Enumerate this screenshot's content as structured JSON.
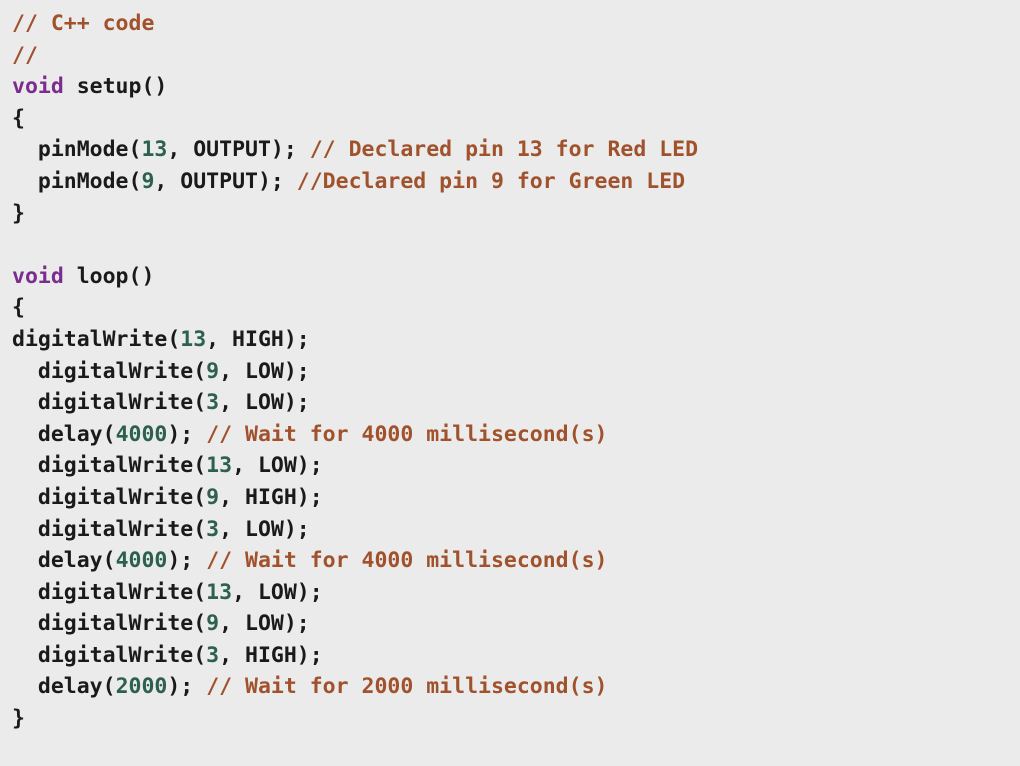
{
  "document": {
    "kind": "code-listing",
    "language": "C++",
    "background_color": "#ebebeb",
    "colors": {
      "plain": "#1a1a1a",
      "keyword": "#7b2d8e",
      "number": "#2d6050",
      "comment": "#a0522d"
    },
    "full_text": "// C++ code\n//\nvoid setup()\n{\n  pinMode(13, OUTPUT); // Declared pin 13 for Red LED\n  pinMode(9, OUTPUT); //Declared pin 9 for Green LED\n}\n\nvoid loop()\n{\ndigitalWrite(13, HIGH);\n  digitalWrite(9, LOW);\n  digitalWrite(3, LOW);\n  delay(4000); // Wait for 4000 millisecond(s)\n  digitalWrite(13, LOW);\n  digitalWrite(9, HIGH);\n  digitalWrite(3, LOW);\n  delay(4000); // Wait for 4000 millisecond(s)\n  digitalWrite(13, LOW);\n  digitalWrite(9, LOW);\n  digitalWrite(3, HIGH);\n  delay(2000); // Wait for 2000 millisecond(s)\n}",
    "lines": [
      {
        "id": 1,
        "text": "// C++ code",
        "tokens": [
          {
            "t": "// C++ code",
            "c": "comment"
          }
        ]
      },
      {
        "id": 2,
        "text": "//",
        "tokens": [
          {
            "t": "//",
            "c": "comment"
          }
        ]
      },
      {
        "id": 3,
        "text": "void setup()",
        "tokens": [
          {
            "t": "void",
            "c": "keyword"
          },
          {
            "t": " setup()",
            "c": "plain"
          }
        ]
      },
      {
        "id": 4,
        "text": "{",
        "tokens": [
          {
            "t": "{",
            "c": "plain"
          }
        ]
      },
      {
        "id": 5,
        "text": "  pinMode(13, OUTPUT); // Declared pin 13 for Red LED",
        "tokens": [
          {
            "t": "  pinMode(",
            "c": "plain"
          },
          {
            "t": "13",
            "c": "number"
          },
          {
            "t": ", OUTPUT); ",
            "c": "plain"
          },
          {
            "t": "// Declared pin 13 for Red LED",
            "c": "comment"
          }
        ]
      },
      {
        "id": 6,
        "text": "  pinMode(9, OUTPUT); //Declared pin 9 for Green LED",
        "tokens": [
          {
            "t": "  pinMode(",
            "c": "plain"
          },
          {
            "t": "9",
            "c": "number"
          },
          {
            "t": ", OUTPUT); ",
            "c": "plain"
          },
          {
            "t": "//Declared pin 9 for Green LED",
            "c": "comment"
          }
        ]
      },
      {
        "id": 7,
        "text": "}",
        "tokens": [
          {
            "t": "}",
            "c": "plain"
          }
        ]
      },
      {
        "id": 8,
        "text": "",
        "tokens": []
      },
      {
        "id": 9,
        "text": "void loop()",
        "tokens": [
          {
            "t": "void",
            "c": "keyword"
          },
          {
            "t": " loop()",
            "c": "plain"
          }
        ]
      },
      {
        "id": 10,
        "text": "{",
        "tokens": [
          {
            "t": "{",
            "c": "plain"
          }
        ]
      },
      {
        "id": 11,
        "text": "digitalWrite(13, HIGH);",
        "tokens": [
          {
            "t": "digitalWrite(",
            "c": "plain"
          },
          {
            "t": "13",
            "c": "number"
          },
          {
            "t": ", HIGH);",
            "c": "plain"
          }
        ]
      },
      {
        "id": 12,
        "text": "  digitalWrite(9, LOW);",
        "tokens": [
          {
            "t": "  digitalWrite(",
            "c": "plain"
          },
          {
            "t": "9",
            "c": "number"
          },
          {
            "t": ", LOW);",
            "c": "plain"
          }
        ]
      },
      {
        "id": 13,
        "text": "  digitalWrite(3, LOW);",
        "tokens": [
          {
            "t": "  digitalWrite(",
            "c": "plain"
          },
          {
            "t": "3",
            "c": "number"
          },
          {
            "t": ", LOW);",
            "c": "plain"
          }
        ]
      },
      {
        "id": 14,
        "text": "  delay(4000); // Wait for 4000 millisecond(s)",
        "tokens": [
          {
            "t": "  delay(",
            "c": "plain"
          },
          {
            "t": "4000",
            "c": "number"
          },
          {
            "t": "); ",
            "c": "plain"
          },
          {
            "t": "// Wait for 4000 millisecond(s)",
            "c": "comment"
          }
        ]
      },
      {
        "id": 15,
        "text": "  digitalWrite(13, LOW);",
        "tokens": [
          {
            "t": "  digitalWrite(",
            "c": "plain"
          },
          {
            "t": "13",
            "c": "number"
          },
          {
            "t": ", LOW);",
            "c": "plain"
          }
        ]
      },
      {
        "id": 16,
        "text": "  digitalWrite(9, HIGH);",
        "tokens": [
          {
            "t": "  digitalWrite(",
            "c": "plain"
          },
          {
            "t": "9",
            "c": "number"
          },
          {
            "t": ", HIGH);",
            "c": "plain"
          }
        ]
      },
      {
        "id": 17,
        "text": "  digitalWrite(3, LOW);",
        "tokens": [
          {
            "t": "  digitalWrite(",
            "c": "plain"
          },
          {
            "t": "3",
            "c": "number"
          },
          {
            "t": ", LOW);",
            "c": "plain"
          }
        ]
      },
      {
        "id": 18,
        "text": "  delay(4000); // Wait for 4000 millisecond(s)",
        "tokens": [
          {
            "t": "  delay(",
            "c": "plain"
          },
          {
            "t": "4000",
            "c": "number"
          },
          {
            "t": "); ",
            "c": "plain"
          },
          {
            "t": "// Wait for 4000 millisecond(s)",
            "c": "comment"
          }
        ]
      },
      {
        "id": 19,
        "text": "  digitalWrite(13, LOW);",
        "tokens": [
          {
            "t": "  digitalWrite(",
            "c": "plain"
          },
          {
            "t": "13",
            "c": "number"
          },
          {
            "t": ", LOW);",
            "c": "plain"
          }
        ]
      },
      {
        "id": 20,
        "text": "  digitalWrite(9, LOW);",
        "tokens": [
          {
            "t": "  digitalWrite(",
            "c": "plain"
          },
          {
            "t": "9",
            "c": "number"
          },
          {
            "t": ", LOW);",
            "c": "plain"
          }
        ]
      },
      {
        "id": 21,
        "text": "  digitalWrite(3, HIGH);",
        "tokens": [
          {
            "t": "  digitalWrite(",
            "c": "plain"
          },
          {
            "t": "3",
            "c": "number"
          },
          {
            "t": ", HIGH);",
            "c": "plain"
          }
        ]
      },
      {
        "id": 22,
        "text": "  delay(2000); // Wait for 2000 millisecond(s)",
        "tokens": [
          {
            "t": "  delay(",
            "c": "plain"
          },
          {
            "t": "2000",
            "c": "number"
          },
          {
            "t": "); ",
            "c": "plain"
          },
          {
            "t": "// Wait for 2000 millisecond(s)",
            "c": "comment"
          }
        ]
      },
      {
        "id": 23,
        "text": "}",
        "tokens": [
          {
            "t": "}",
            "c": "plain"
          }
        ]
      }
    ]
  }
}
